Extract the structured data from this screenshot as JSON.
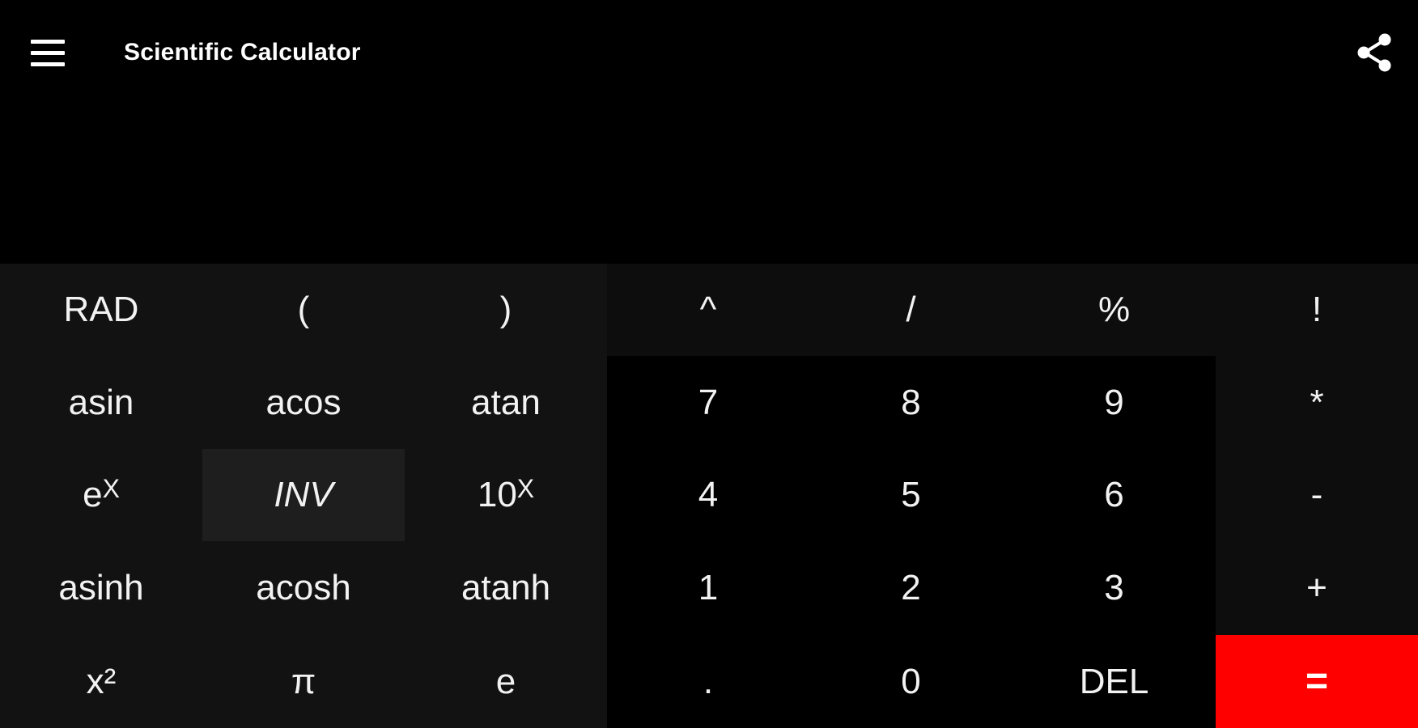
{
  "app": {
    "title": "Scientific Calculator"
  },
  "toolbar": {
    "menu_icon": "hamburger-menu-icon",
    "share_icon": "share-icon"
  },
  "display": {
    "value": ""
  },
  "keys": {
    "rad": "RAD",
    "open_paren": "(",
    "close_paren": ")",
    "caret": "^",
    "divide": "/",
    "percent": "%",
    "factorial": "!",
    "asin": "asin",
    "acos": "acos",
    "atan": "atan",
    "seven": "7",
    "eight": "8",
    "nine": "9",
    "multiply": "*",
    "exp_base": "e",
    "exp_power": "X",
    "inv": "INV",
    "ten_base": "10",
    "ten_power": "X",
    "four": "4",
    "five": "5",
    "six": "6",
    "minus": "-",
    "asinh": "asinh",
    "acosh": "acosh",
    "atanh": "atanh",
    "one": "1",
    "two": "2",
    "three": "3",
    "plus": "+",
    "square": "x²",
    "pi": "π",
    "e_const": "e",
    "dot": ".",
    "zero": "0",
    "del": "DEL",
    "equals": "="
  },
  "colors": {
    "background": "#000000",
    "sci_key": "#121212",
    "operator_key": "#0d0d0d",
    "inv_key": "#1e1e1e",
    "equals_key": "#fe0000"
  }
}
